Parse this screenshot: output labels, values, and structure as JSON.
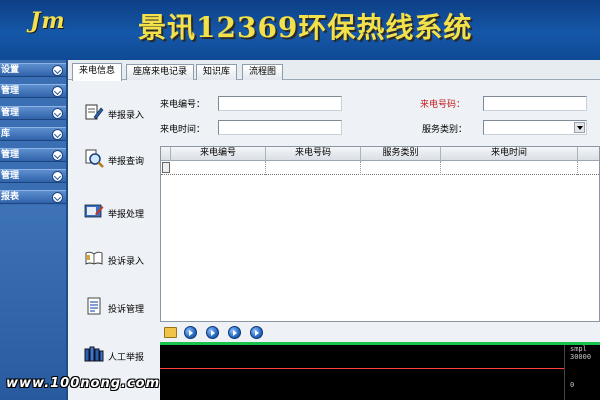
{
  "header": {
    "logo": "Jm",
    "title": "景讯12369环保热线系统"
  },
  "sidebar": {
    "items": [
      {
        "label": "设置"
      },
      {
        "label": "管理"
      },
      {
        "label": "管理"
      },
      {
        "label": "库"
      },
      {
        "label": "管理"
      },
      {
        "label": "管理"
      },
      {
        "label": "报表"
      }
    ]
  },
  "tabs": [
    {
      "label": "来电信息",
      "active": true
    },
    {
      "label": "座席来电记录",
      "active": false
    },
    {
      "label": "知识库",
      "active": false
    },
    {
      "label": "流程图",
      "active": false
    }
  ],
  "actions": [
    {
      "label": "举报录入",
      "icon": "report-entry-icon"
    },
    {
      "label": "举报查询",
      "icon": "search-magnifier-icon"
    },
    {
      "label": "举报处理",
      "icon": "report-process-icon"
    },
    {
      "label": "投诉录入",
      "icon": "book-icon"
    },
    {
      "label": "投诉管理",
      "icon": "document-list-icon"
    },
    {
      "label": "人工举报",
      "icon": "people-icon"
    }
  ],
  "form": {
    "call_id_label": "来电编号：",
    "caller_number_label": "来电号码：",
    "call_time_label": "来电时间：",
    "service_type_label": "服务类别：",
    "call_id_value": "",
    "caller_number_value": "",
    "call_time_value": "",
    "service_type_value": ""
  },
  "grid": {
    "columns": [
      "来电编号",
      "来电号码",
      "服务类别",
      "来电时间"
    ],
    "rows": []
  },
  "player": {
    "scale_label": "smpl",
    "scale_top": "30000",
    "scale_mid": "0"
  },
  "watermark": "www.100nong.com",
  "colors": {
    "header_blue": "#1557a8",
    "title_yellow": "#f2e14a",
    "sidebar_blue": "#3b6fb3",
    "waveform_green": "#19c24a",
    "waveform_red": "#ff4040",
    "label_red": "#c01a1a"
  }
}
